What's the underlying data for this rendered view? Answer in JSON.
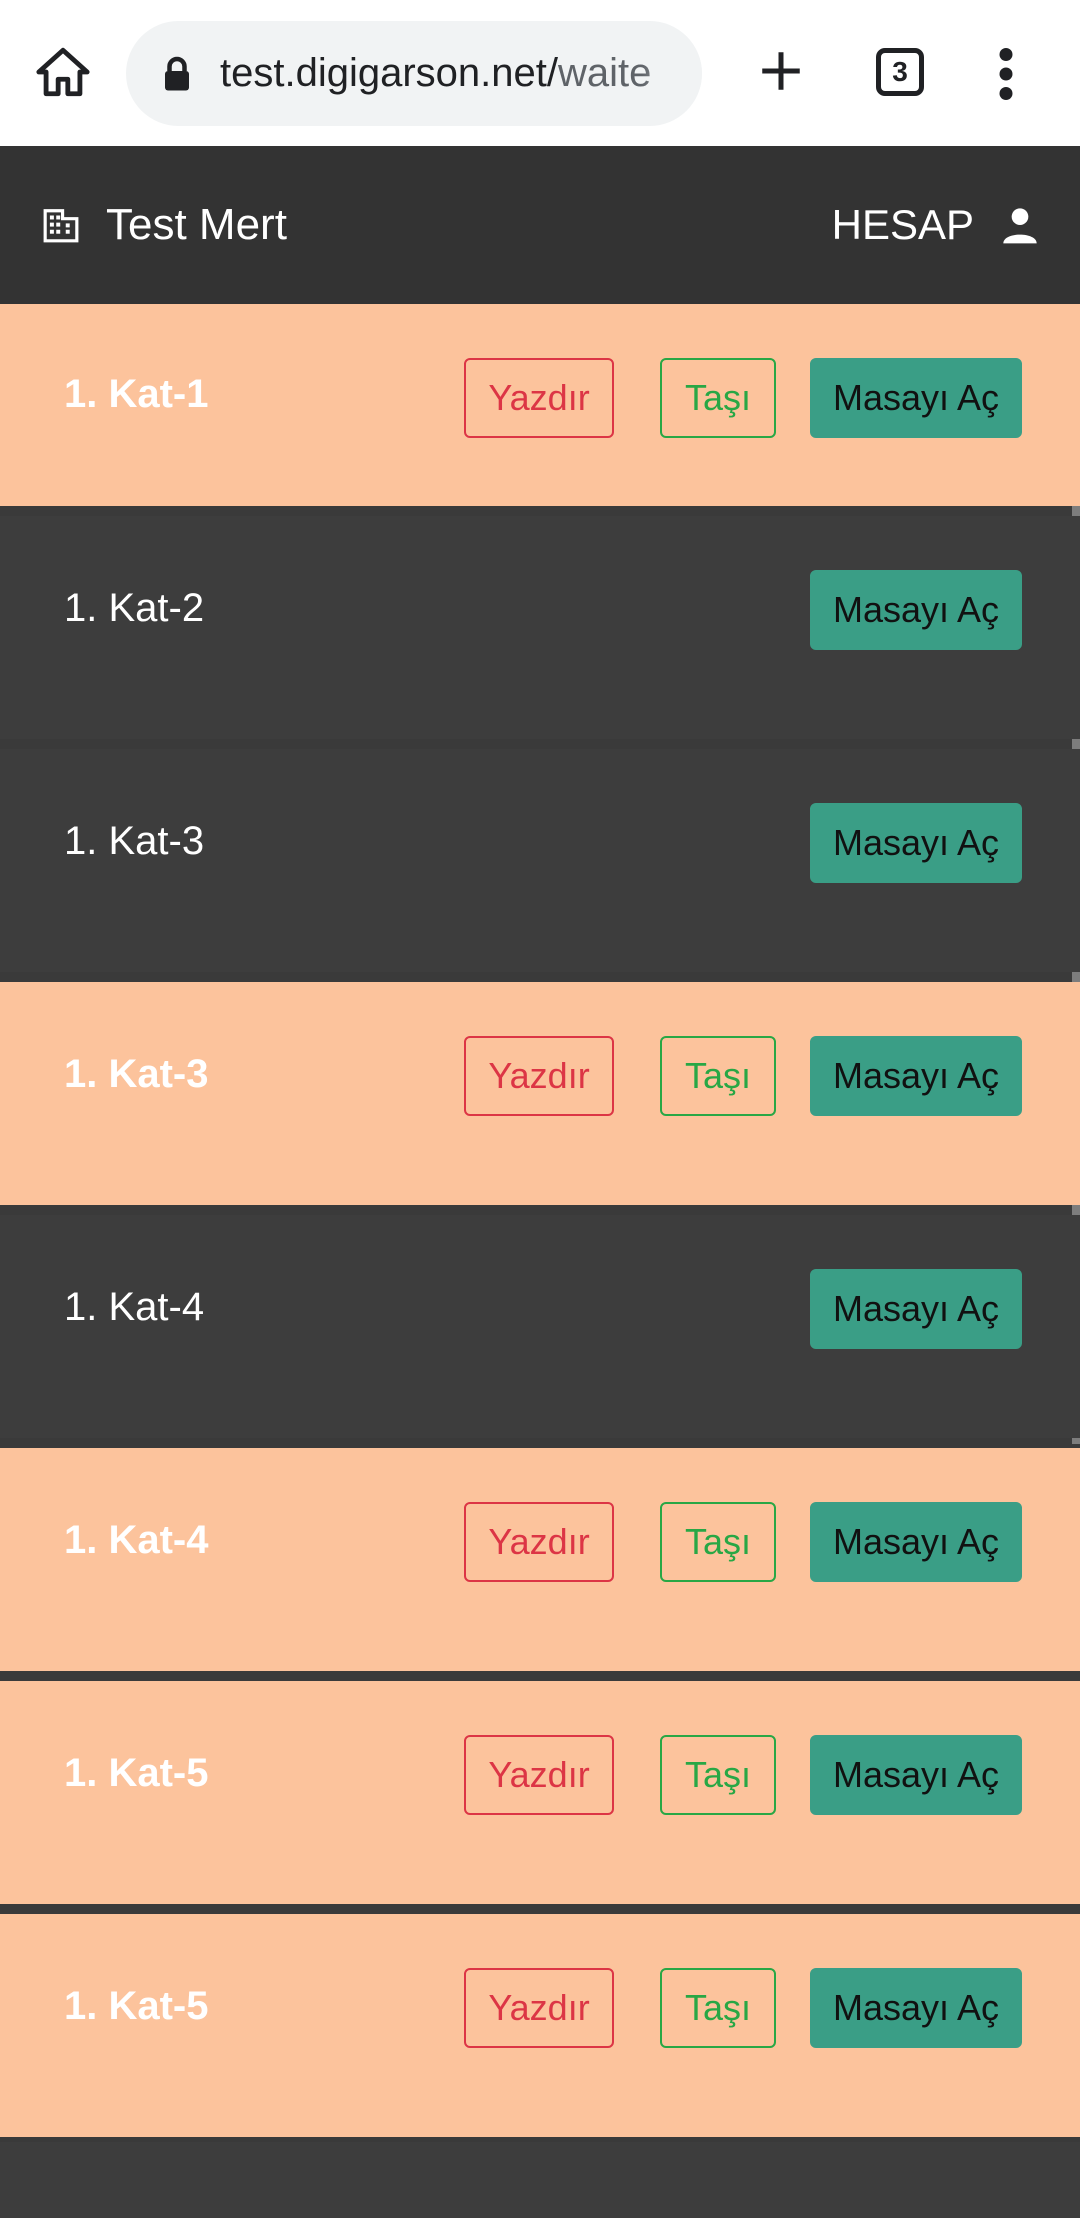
{
  "browser": {
    "url_main": "test.digigarson.net/",
    "url_rest": "waite",
    "tab_count": "3"
  },
  "header": {
    "title": "Test Mert",
    "account_label": "HESAP"
  },
  "colors": {
    "occupied_row": "#fcc39c",
    "empty_row": "#3d3d3d",
    "header_bg": "#333333",
    "open_button": "#3a9e86",
    "print_button": "#dc3545",
    "move_button": "#28a745"
  },
  "tables": [
    {
      "name": "1. Kat-1",
      "occupied": true
    },
    {
      "name": "1. Kat-2",
      "occupied": false
    },
    {
      "name": "1. Kat-3",
      "occupied": false
    },
    {
      "name": "1. Kat-3",
      "occupied": true
    },
    {
      "name": "1. Kat-4",
      "occupied": false
    },
    {
      "name": "1. Kat-4",
      "occupied": true
    },
    {
      "name": "1. Kat-5",
      "occupied": true
    },
    {
      "name": "1. Kat-5",
      "occupied": true
    }
  ],
  "buttons": {
    "print_label": "Yazdır",
    "move_label": "Taşı",
    "open_label": "Masayı Aç"
  }
}
